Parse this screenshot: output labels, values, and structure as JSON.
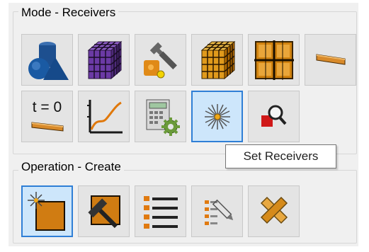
{
  "mode_group": {
    "title": "Mode - Receivers",
    "buttons": [
      {
        "icon": "shapes-icon"
      },
      {
        "icon": "purple-grid-cube-icon"
      },
      {
        "icon": "wrench-tool-icon"
      },
      {
        "icon": "orange-grid-cube-icon"
      },
      {
        "icon": "grid-panel-icon"
      },
      {
        "icon": "slab-icon"
      },
      {
        "icon": "time-zero-icon",
        "label": "t = 0"
      },
      {
        "icon": "line-graph-icon"
      },
      {
        "icon": "calculator-gear-icon"
      },
      {
        "icon": "starburst-icon",
        "active": true
      },
      {
        "icon": "inspect-magnifier-icon"
      }
    ]
  },
  "operation_group": {
    "title": "Operation - Create",
    "buttons": [
      {
        "icon": "create-new-icon",
        "active": true
      },
      {
        "icon": "hammer-icon"
      },
      {
        "icon": "list-icon"
      },
      {
        "icon": "edit-list-icon"
      },
      {
        "icon": "delete-x-icon"
      }
    ]
  },
  "tooltip": {
    "text": "Set Receivers"
  },
  "colors": {
    "accent": "#2f7fd6",
    "active_bg": "#cde6fb",
    "orange": "#d98a1f"
  }
}
